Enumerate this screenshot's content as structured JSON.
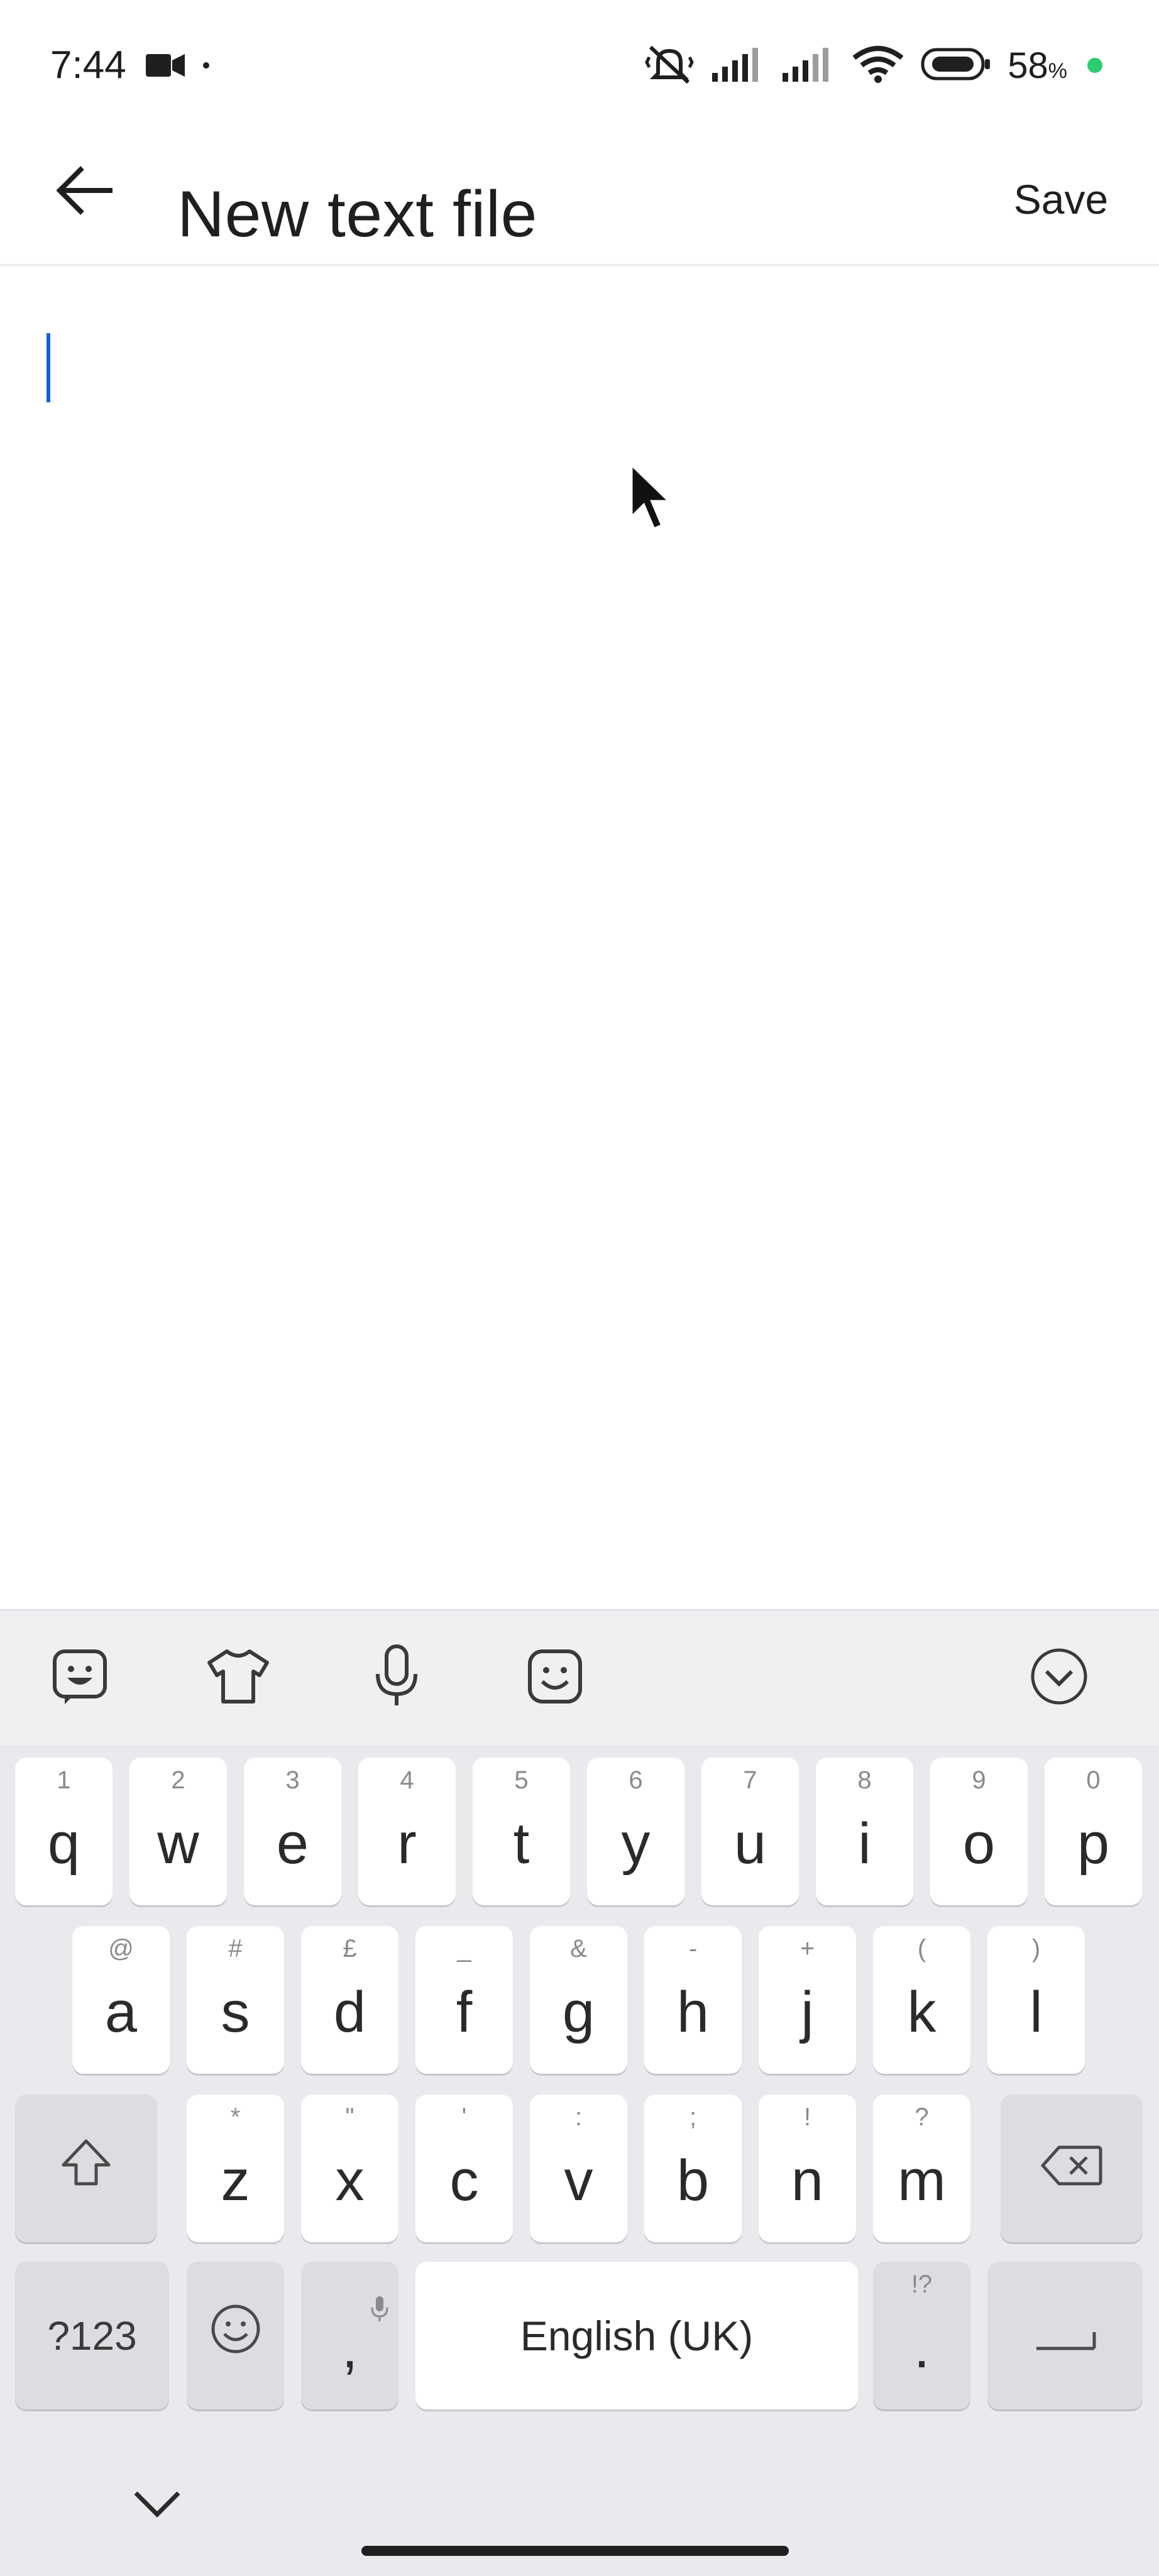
{
  "status_bar": {
    "time": "7:44",
    "battery_percent": "58",
    "battery_unit": "%",
    "icons": [
      "video-icon",
      "dot-icon",
      "silent-icon",
      "signal-1-icon",
      "signal-2-icon",
      "wifi-icon",
      "battery-icon"
    ]
  },
  "app_bar": {
    "title": "New text file",
    "save_label": "Save",
    "back_icon": "arrow-left-icon"
  },
  "editor": {
    "content": ""
  },
  "keyboard": {
    "toolbar_icons": [
      "sticker-icon",
      "theme-shirt-icon",
      "microphone-icon",
      "emoji-face-icon",
      "collapse-chevron-icon"
    ],
    "row1": [
      {
        "main": "q",
        "hint": "1"
      },
      {
        "main": "w",
        "hint": "2"
      },
      {
        "main": "e",
        "hint": "3"
      },
      {
        "main": "r",
        "hint": "4"
      },
      {
        "main": "t",
        "hint": "5"
      },
      {
        "main": "y",
        "hint": "6"
      },
      {
        "main": "u",
        "hint": "7"
      },
      {
        "main": "i",
        "hint": "8"
      },
      {
        "main": "o",
        "hint": "9"
      },
      {
        "main": "p",
        "hint": "0"
      }
    ],
    "row2": [
      {
        "main": "a",
        "hint": "@"
      },
      {
        "main": "s",
        "hint": "#"
      },
      {
        "main": "d",
        "hint": "£"
      },
      {
        "main": "f",
        "hint": "_"
      },
      {
        "main": "g",
        "hint": "&"
      },
      {
        "main": "h",
        "hint": "-"
      },
      {
        "main": "j",
        "hint": "+"
      },
      {
        "main": "k",
        "hint": "("
      },
      {
        "main": "l",
        "hint": ")"
      }
    ],
    "row3": [
      {
        "main": "z",
        "hint": "*"
      },
      {
        "main": "x",
        "hint": "\""
      },
      {
        "main": "c",
        "hint": "'"
      },
      {
        "main": "v",
        "hint": ":"
      },
      {
        "main": "b",
        "hint": ";"
      },
      {
        "main": "n",
        "hint": "!"
      },
      {
        "main": "m",
        "hint": "?"
      }
    ],
    "symbols_label": "?123",
    "comma_label": ",",
    "space_label": "English (UK)",
    "period_label": ".",
    "period_hint": "!?"
  },
  "colors": {
    "caret": "#1a5fd1",
    "keyboard_bg": "#e9eaed",
    "key_bg": "#ffffff",
    "function_key_bg": "#dcdde1",
    "battery_dot": "#2ecc71"
  }
}
